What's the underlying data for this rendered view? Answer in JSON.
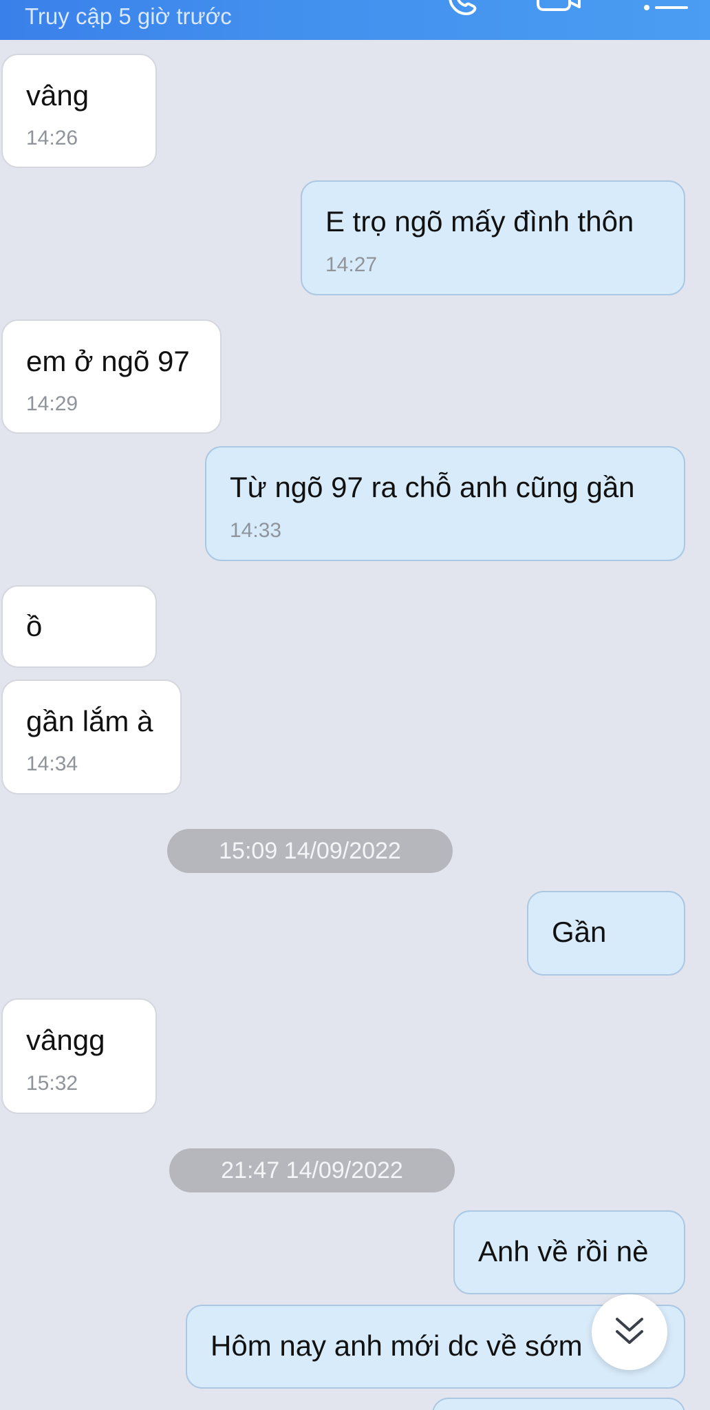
{
  "header": {
    "status": "Truy cập 5 giờ trước",
    "icons": [
      "phone-icon",
      "video-call-icon",
      "menu-icon"
    ]
  },
  "messages": [
    {
      "side": "incoming",
      "text": "vâng",
      "time": "14:26"
    },
    {
      "side": "outgoing",
      "text": "E trọ ngõ mấy đình thôn",
      "time": "14:27"
    },
    {
      "side": "incoming",
      "text": "em ở ngõ 97",
      "time": "14:29"
    },
    {
      "side": "outgoing",
      "text": "Từ ngõ 97 ra chỗ anh cũng gần",
      "time": "14:33"
    },
    {
      "side": "incoming",
      "text": "ồ"
    },
    {
      "side": "incoming",
      "text": "gần lắm à",
      "time": "14:34"
    },
    {
      "type": "date",
      "text": "15:09 14/09/2022"
    },
    {
      "side": "outgoing",
      "text": "Gần"
    },
    {
      "side": "incoming",
      "text": "vângg",
      "time": "15:32"
    },
    {
      "type": "date",
      "text": "21:47 14/09/2022"
    },
    {
      "side": "outgoing",
      "text": "Anh về rồi nè"
    },
    {
      "side": "outgoing",
      "text": "Hôm nay anh mới dc về sớm"
    }
  ],
  "scroll_button": {
    "icon": "double-chevron-down-icon"
  },
  "colors": {
    "header": "#3a80ea",
    "background": "#e3e5ee",
    "incoming_bubble": "#ffffff",
    "outgoing_bubble": "#d8ebfa",
    "date_pill": "#b5b7bd"
  }
}
